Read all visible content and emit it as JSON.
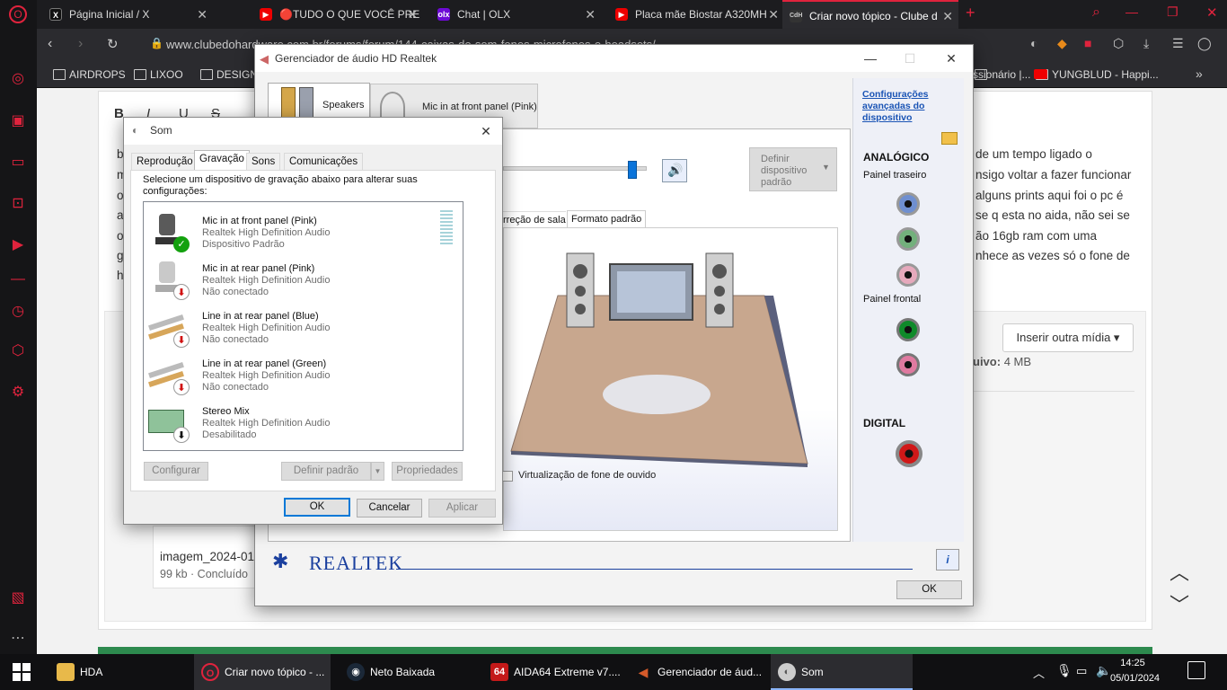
{
  "browser": {
    "tabs": [
      {
        "label": "Página Inicial / X",
        "icon": "x-icon"
      },
      {
        "label": "🔴TUDO O QUE VOCÊ PRE",
        "icon": "youtube-icon"
      },
      {
        "label": "Chat | OLX",
        "icon": "olx-icon"
      },
      {
        "label": "Placa mãe Biostar A320MH",
        "icon": "youtube-icon"
      },
      {
        "label": "Criar novo tópico - Clube d",
        "icon": "cdh-icon"
      }
    ],
    "url": "www.clubedohardware.com.br/forums/forum/144-caixas-de-som-fones-microfones-e-headsets/",
    "bookmarks": [
      "AIRDROPS",
      "LIXOO",
      "DESIGN",
      "ssionário |...",
      "YUNGBLUD - Happi..."
    ]
  },
  "webpage": {
    "post_lines": [
      "de um tempo ligado o",
      "nsigo voltar a fazer funcionar",
      "alguns prints aqui foi o pc é",
      "se q esta no aida, não sei se",
      "ão 16gb ram com uma",
      "nhece as vezes só o fone de"
    ],
    "left_fragments": [
      "b",
      "m",
      "o",
      "a",
      "o",
      "g",
      "h"
    ],
    "insert_media": "Inserir outra mídia",
    "file_label": "uivo:",
    "file_size": "4 MB",
    "attachment_name": "imagem_2024-01",
    "attachment_info": "99 kb · Concluído",
    "editor_buttons": [
      "B",
      "I",
      "U",
      "S"
    ]
  },
  "realtek": {
    "title": "Gerenciador de áudio HD Realtek",
    "device_tabs": [
      "Speakers",
      "Mic in at front panel (Pink)"
    ],
    "set_default": "Definir dispositivo padrão",
    "sub_tabs": [
      "rreção de sala",
      "Formato padrão"
    ],
    "headphone_virtualization": "Virtualização de fone de ouvido",
    "advanced_link": "Configurações avançadas do dispositivo",
    "analog_label": "ANALÓGICO",
    "rear_panel": "Painel traseiro",
    "front_panel": "Painel frontal",
    "digital_label": "DIGITAL",
    "brand": "REALTEK",
    "ok": "OK",
    "volume_fraction": 0.9,
    "jack_colors": {
      "blue": "#6f8fd0",
      "green": "#73b07c",
      "pink": "#e6a9bc",
      "front_green": "#0f8a2a",
      "front_pink": "#e07aa0",
      "digital": "#d01818"
    }
  },
  "som": {
    "title": "Som",
    "tabs": [
      "Reprodução",
      "Gravação",
      "Sons",
      "Comunicações"
    ],
    "active_tab": "Gravação",
    "instruction": "Selecione um dispositivo de gravação abaixo para alterar suas configurações:",
    "devices": [
      {
        "name": "Mic in at front panel (Pink)",
        "driver": "Realtek High Definition Audio",
        "status": "Dispositivo Padrão",
        "icon": "microphone-icon",
        "badge": "check-icon"
      },
      {
        "name": "Mic in at rear panel (Pink)",
        "driver": "Realtek High Definition Audio",
        "status": "Não conectado",
        "icon": "microphone-icon",
        "badge": "down-arrow-icon"
      },
      {
        "name": "Line in at rear panel (Blue)",
        "driver": "Realtek High Definition Audio",
        "status": "Não conectado",
        "icon": "rca-cable-icon",
        "badge": "down-arrow-icon"
      },
      {
        "name": "Line in at rear panel (Green)",
        "driver": "Realtek High Definition Audio",
        "status": "Não conectado",
        "icon": "rca-cable-icon",
        "badge": "down-arrow-icon"
      },
      {
        "name": "Stereo Mix",
        "driver": "Realtek High Definition Audio",
        "status": "Desabilitado",
        "icon": "sound-card-icon",
        "badge": "down-arrow-icon"
      }
    ],
    "configure": "Configurar",
    "set_default": "Definir padrão",
    "properties": "Propriedades",
    "ok": "OK",
    "cancel": "Cancelar",
    "apply": "Aplicar"
  },
  "taskbar": {
    "items": [
      {
        "label": "HDA",
        "icon": "folder-icon"
      },
      {
        "label": "Criar novo tópico - ...",
        "icon": "opera-icon"
      },
      {
        "label": "Neto Baixada",
        "icon": "steam-icon"
      },
      {
        "label": "AIDA64 Extreme v7....",
        "icon": "aida64-icon"
      },
      {
        "label": "Gerenciador de áud...",
        "icon": "speaker-icon"
      },
      {
        "label": "Som",
        "icon": "sound-icon"
      }
    ],
    "time": "14:25",
    "date": "05/01/2024"
  }
}
